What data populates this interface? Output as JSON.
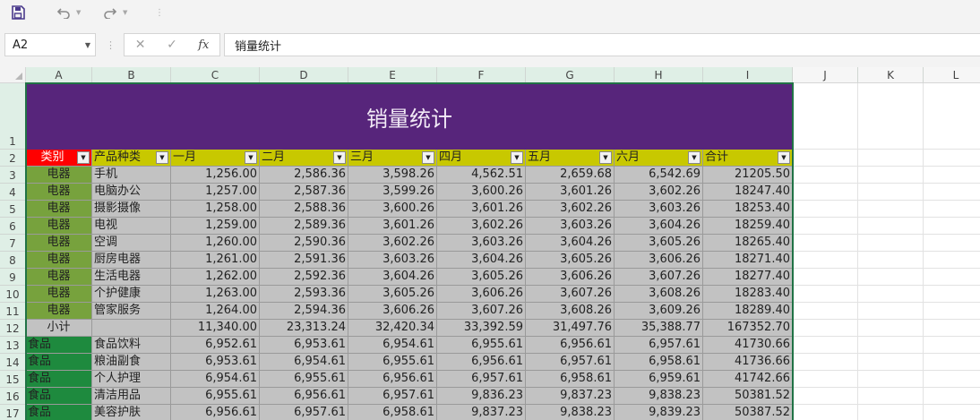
{
  "quick_access": {
    "save_icon": "save-icon",
    "undo_icon": "undo-icon",
    "redo_icon": "redo-icon",
    "more_glyph": "⋮"
  },
  "formula_bar": {
    "name_box": "A2",
    "cancel_glyph": "✕",
    "enter_glyph": "✓",
    "fx_label": "fx",
    "formula_value": "销量统计"
  },
  "columns": [
    "A",
    "B",
    "C",
    "D",
    "E",
    "F",
    "G",
    "H",
    "I",
    "J",
    "K",
    "L"
  ],
  "title": "销量统计",
  "headers": [
    "类别",
    "产品种类",
    "一月",
    "二月",
    "三月",
    "四月",
    "五月",
    "六月",
    "合计"
  ],
  "filter_glyph": "▼",
  "rows": [
    {
      "n": "3",
      "cat": "电器",
      "product": "手机",
      "vals": [
        "1,256.00",
        "2,586.36",
        "3,598.26",
        "4,562.51",
        "2,659.68",
        "6,542.69"
      ],
      "total": "21205.50"
    },
    {
      "n": "4",
      "cat": "电器",
      "product": "电脑办公",
      "vals": [
        "1,257.00",
        "2,587.36",
        "3,599.26",
        "3,600.26",
        "3,601.26",
        "3,602.26"
      ],
      "total": "18247.40"
    },
    {
      "n": "5",
      "cat": "电器",
      "product": "摄影摄像",
      "vals": [
        "1,258.00",
        "2,588.36",
        "3,600.26",
        "3,601.26",
        "3,602.26",
        "3,603.26"
      ],
      "total": "18253.40"
    },
    {
      "n": "6",
      "cat": "电器",
      "product": "电视",
      "vals": [
        "1,259.00",
        "2,589.36",
        "3,601.26",
        "3,602.26",
        "3,603.26",
        "3,604.26"
      ],
      "total": "18259.40"
    },
    {
      "n": "7",
      "cat": "电器",
      "product": "空调",
      "vals": [
        "1,260.00",
        "2,590.36",
        "3,602.26",
        "3,603.26",
        "3,604.26",
        "3,605.26"
      ],
      "total": "18265.40"
    },
    {
      "n": "8",
      "cat": "电器",
      "product": "厨房电器",
      "vals": [
        "1,261.00",
        "2,591.36",
        "3,603.26",
        "3,604.26",
        "3,605.26",
        "3,606.26"
      ],
      "total": "18271.40"
    },
    {
      "n": "9",
      "cat": "电器",
      "product": "生活电器",
      "vals": [
        "1,262.00",
        "2,592.36",
        "3,604.26",
        "3,605.26",
        "3,606.26",
        "3,607.26"
      ],
      "total": "18277.40"
    },
    {
      "n": "10",
      "cat": "电器",
      "product": "个护健康",
      "vals": [
        "1,263.00",
        "2,593.36",
        "3,605.26",
        "3,606.26",
        "3,607.26",
        "3,608.26"
      ],
      "total": "18283.40"
    },
    {
      "n": "11",
      "cat": "电器",
      "product": "管家服务",
      "vals": [
        "1,264.00",
        "2,594.36",
        "3,606.26",
        "3,607.26",
        "3,608.26",
        "3,609.26"
      ],
      "total": "18289.40"
    },
    {
      "n": "12",
      "cat": "小计",
      "product": "",
      "vals": [
        "11,340.00",
        "23,313.24",
        "32,420.34",
        "33,392.59",
        "31,497.76",
        "35,388.77"
      ],
      "total": "167352.70"
    },
    {
      "n": "13",
      "cat": "食品",
      "product": "食品饮料",
      "vals": [
        "6,952.61",
        "6,953.61",
        "6,954.61",
        "6,955.61",
        "6,956.61",
        "6,957.61"
      ],
      "total": "41730.66"
    },
    {
      "n": "14",
      "cat": "食品",
      "product": "粮油副食",
      "vals": [
        "6,953.61",
        "6,954.61",
        "6,955.61",
        "6,956.61",
        "6,957.61",
        "6,958.61"
      ],
      "total": "41736.66"
    },
    {
      "n": "15",
      "cat": "食品",
      "product": "个人护理",
      "vals": [
        "6,954.61",
        "6,955.61",
        "6,956.61",
        "6,957.61",
        "6,958.61",
        "6,959.61"
      ],
      "total": "41742.66"
    },
    {
      "n": "16",
      "cat": "食品",
      "product": "清洁用品",
      "vals": [
        "6,955.61",
        "6,956.61",
        "6,957.61",
        "9,836.23",
        "9,837.23",
        "9,838.23"
      ],
      "total": "50381.52"
    },
    {
      "n": "17",
      "cat": "食品",
      "product": "美容护肤",
      "vals": [
        "6,956.61",
        "6,957.61",
        "6,958.61",
        "9,837.23",
        "9,838.23",
        "9,839.23"
      ],
      "total": "50387.52"
    }
  ],
  "colors": {
    "title_bg": "#57257b",
    "header_bg": "#c8c800",
    "category_header_bg": "#ff0000",
    "electronics_bg": "#77a23d",
    "food_bg": "#1e8a3e",
    "data_bg": "#c2c2c2",
    "selection": "#217346"
  }
}
